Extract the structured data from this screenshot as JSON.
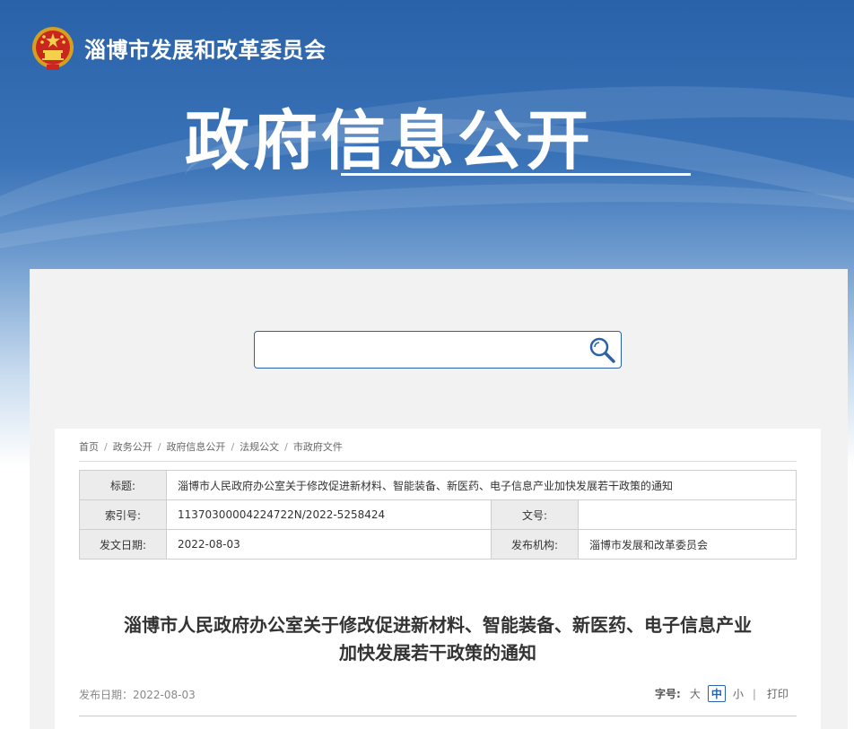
{
  "header": {
    "org_name": "淄博市发展和改革委员会",
    "site_title": "政府信息公开",
    "emblem_icon": "national-emblem-icon"
  },
  "search": {
    "placeholder": "",
    "icon": "search-icon"
  },
  "breadcrumb": [
    "首页",
    "政务公开",
    "政府信息公开",
    "法规公文",
    "市政府文件"
  ],
  "meta": {
    "title_label": "标题:",
    "title_value": "淄博市人民政府办公室关于修改促进新材料、智能装备、新医药、电子信息产业加快发展若干政策的通知",
    "index_label": "索引号:",
    "index_value": "11370300004224722N/2022-5258424",
    "docno_label": "文号:",
    "docno_value": "",
    "date_label": "发文日期:",
    "date_value": "2022-08-03",
    "issuer_label": "发布机构:",
    "issuer_value": "淄博市发展和改革委员会"
  },
  "article": {
    "title_line1": "淄博市人民政府办公室关于修改促进新材料、智能装备、新医药、电子信息产业",
    "title_line2": "加快发展若干政策的通知",
    "pub_date": "发布日期：2022-08-03"
  },
  "font_size": {
    "label": "字号:",
    "large": "大",
    "medium": "中",
    "small": "小",
    "divider": "|",
    "print": "打印"
  },
  "colors": {
    "brand": "#2a62a9"
  }
}
